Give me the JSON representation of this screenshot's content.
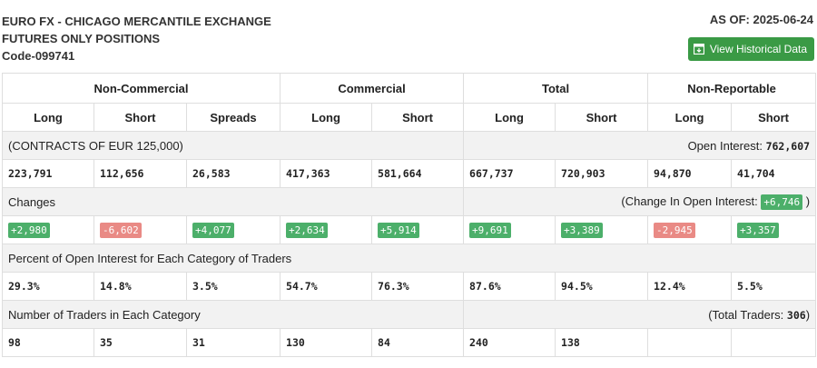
{
  "header": {
    "title_line1": "EURO FX - CHICAGO MERCANTILE EXCHANGE",
    "title_line2": "FUTURES ONLY POSITIONS",
    "code": "Code-099741",
    "as_of": "AS OF: 2025-06-24",
    "history_button": "View Historical Data",
    "history_icon": "calendar-download-icon",
    "button_color": "#3a9a45"
  },
  "columns": {
    "groups": [
      "Non-Commercial",
      "Commercial",
      "Total",
      "Non-Reportable"
    ],
    "subs": [
      "Long",
      "Short",
      "Spreads",
      "Long",
      "Short",
      "Long",
      "Short",
      "Long",
      "Short"
    ]
  },
  "contracts": {
    "label": "(CONTRACTS OF EUR 125,000)",
    "oi_label": "Open Interest:",
    "oi_value": "762,607",
    "values": [
      "223,791",
      "112,656",
      "26,583",
      "417,363",
      "581,664",
      "667,737",
      "720,903",
      "94,870",
      "41,704"
    ]
  },
  "changes": {
    "label": "Changes",
    "oi_prefix": "(Change In Open Interest:",
    "oi_value": "+6,746",
    "oi_suffix": ")",
    "values": [
      "+2,980",
      "-6,602",
      "+4,077",
      "+2,634",
      "+5,914",
      "+9,691",
      "+3,389",
      "-2,945",
      "+3,357"
    ],
    "positive_color": "#4caf6a",
    "negative_color": "#e98a85"
  },
  "percent": {
    "label": "Percent of Open Interest for Each Category of Traders",
    "values": [
      "29.3%",
      "14.8%",
      "3.5%",
      "54.7%",
      "76.3%",
      "87.6%",
      "94.5%",
      "12.4%",
      "5.5%"
    ]
  },
  "traders": {
    "label": "Number of Traders in Each Category",
    "total_prefix": "(Total Traders:",
    "total_value": "306",
    "total_suffix": ")",
    "values": [
      "98",
      "35",
      "31",
      "130",
      "84",
      "240",
      "138",
      "",
      ""
    ]
  }
}
